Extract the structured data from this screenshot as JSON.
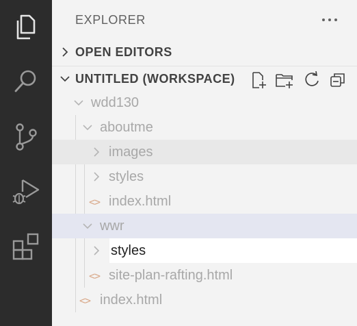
{
  "activity_bar": {
    "items": [
      {
        "icon": "files-icon",
        "active": true
      },
      {
        "icon": "search-icon"
      },
      {
        "icon": "source-control-icon"
      },
      {
        "icon": "run-debug-icon"
      },
      {
        "icon": "extensions-icon"
      }
    ]
  },
  "explorer": {
    "title": "EXPLORER",
    "more_icon": "ellipsis-icon"
  },
  "sections": {
    "open_editors": "OPEN EDITORS",
    "workspace": "UNTITLED (WORKSPACE)"
  },
  "workspace_actions": [
    "new-file-icon",
    "new-folder-icon",
    "refresh-icon",
    "collapse-all-icon"
  ],
  "tree": {
    "root": "wdd130",
    "aboutme": "aboutme",
    "images": "images",
    "aboutme_styles": "styles",
    "aboutme_index": "index.html",
    "wwr": "wwr",
    "wwr_rename_value": "styles",
    "site_plan": "site-plan-rafting.html",
    "root_index": "index.html",
    "file_icon_glyph": "<>"
  },
  "colors": {
    "activity_bar_bg": "#2c2c2c",
    "sidebar_bg": "#f3f3f3",
    "selected_row": "#e4e6f1",
    "hover_row": "#e8e8e8",
    "html_icon": "#d9a98a"
  }
}
